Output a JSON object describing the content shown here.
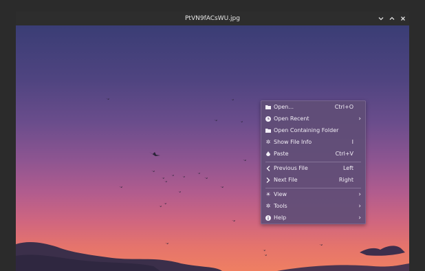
{
  "window": {
    "title": "PtVN9fACsWU.jpg"
  },
  "window_controls": {
    "minimize_icon": "chevron-down-icon",
    "maximize_icon": "chevron-up-icon",
    "close_icon": "close-icon"
  },
  "context_menu": {
    "items": [
      {
        "label": "Open...",
        "shortcut": "Ctrl+O",
        "icon": "folder-icon"
      },
      {
        "label": "Open Recent",
        "shortcut": "",
        "icon": "clock-icon",
        "submenu": true
      },
      {
        "label": "Open Containing Folder",
        "shortcut": "",
        "icon": "folder-icon"
      },
      {
        "label": "Show File Info",
        "shortcut": "I",
        "icon": "gear-icon"
      },
      {
        "label": "Paste",
        "shortcut": "Ctrl+V",
        "icon": "clipboard-icon"
      },
      {
        "label": "Previous File",
        "shortcut": "Left",
        "icon": "chevron-left-icon"
      },
      {
        "label": "Next File",
        "shortcut": "Right",
        "icon": "chevron-right-icon"
      },
      {
        "label": "View",
        "shortcut": "",
        "icon": "sun-icon",
        "submenu": true
      },
      {
        "label": "Tools",
        "shortcut": "",
        "icon": "gear-icon",
        "submenu": true
      },
      {
        "label": "Help",
        "shortcut": "",
        "icon": "info-icon",
        "submenu": true
      }
    ]
  },
  "colors": {
    "titlebar": "#2d2d2d",
    "menu_background": "#604e76",
    "sky_top": "#3a3d75",
    "sky_bottom": "#ef7f62"
  }
}
